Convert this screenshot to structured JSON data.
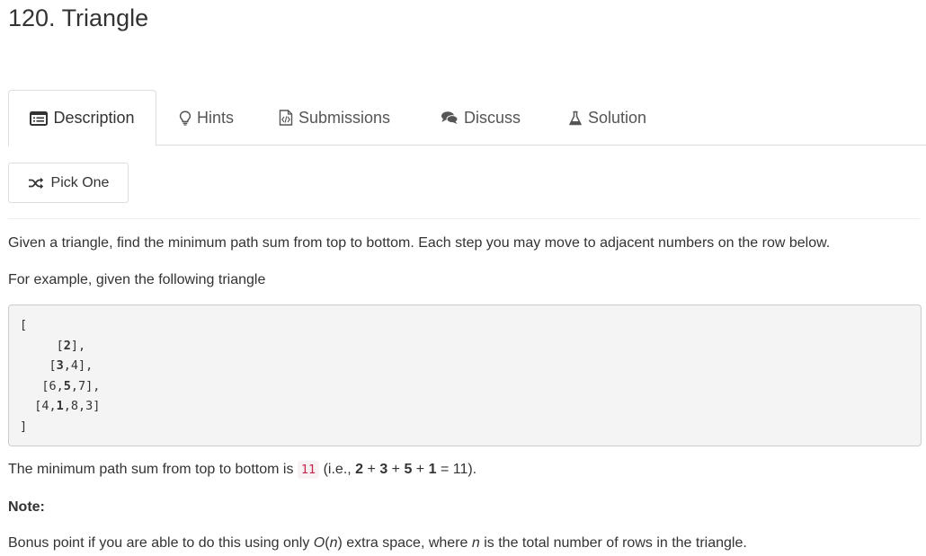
{
  "problem": {
    "title": "120. Triangle"
  },
  "tabs": [
    {
      "label": "Description",
      "icon": "list-icon",
      "active": true
    },
    {
      "label": "Hints",
      "icon": "lightbulb-icon"
    },
    {
      "label": "Submissions",
      "icon": "code-file-icon"
    },
    {
      "label": "Discuss",
      "icon": "comments-icon"
    },
    {
      "label": "Solution",
      "icon": "flask-icon"
    }
  ],
  "pick_one": {
    "label": "Pick One",
    "icon": "shuffle-icon"
  },
  "content": {
    "intro": "Given a triangle, find the minimum path sum from top to bottom. Each step you may move to adjacent numbers on the row below.",
    "example_intro": "For example, given the following triangle",
    "code_open": "[",
    "code_rows": [
      {
        "indent": "     ",
        "pre": "[",
        "bold": "2",
        "post": "],"
      },
      {
        "indent": "    ",
        "pre": "[",
        "bold": "3",
        "post": ",4],"
      },
      {
        "indent": "   ",
        "pre": "[6,",
        "bold": "5",
        "post": ",7],"
      },
      {
        "indent": "  ",
        "pre": "[4,",
        "bold": "1",
        "post": ",8,3]"
      }
    ],
    "code_close": "]",
    "result_text": "The minimum path sum from top to bottom is ",
    "result_value": "11",
    "result_paren_open": " (i.e., ",
    "result_terms": [
      "2",
      "3",
      "5",
      "1"
    ],
    "result_plus": " + ",
    "result_equals": " = 11).",
    "note_label": "Note:",
    "bonus_pre": "Bonus point if you are able to do this using only ",
    "bonus_O": "O",
    "bonus_paren_open": "(",
    "bonus_n": "n",
    "bonus_paren_close": ")",
    "bonus_mid": " extra space, where ",
    "bonus_n2": "n",
    "bonus_post": " is the total number of rows in the triangle."
  }
}
